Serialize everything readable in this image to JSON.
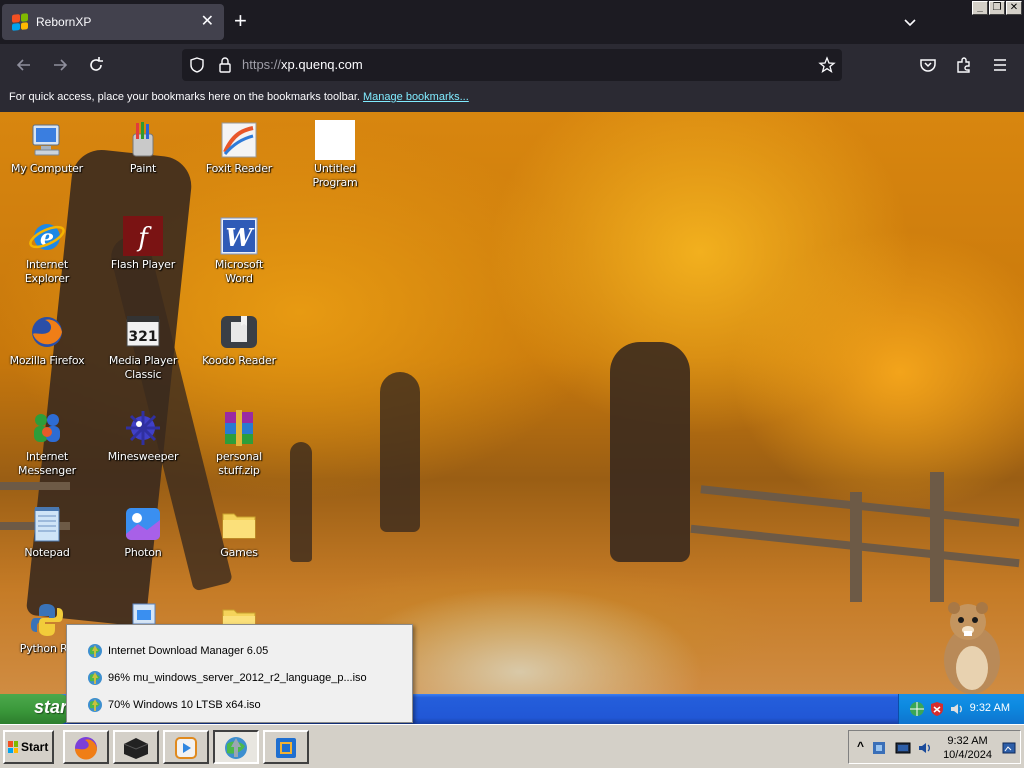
{
  "browser": {
    "tab_title": "RebornXP",
    "tab_close_glyph": "✕",
    "new_tab_glyph": "+",
    "url_scheme": "https://",
    "url_host": "xp.quenq.com",
    "bookmarks_hint": "For quick access, place your bookmarks here on the bookmarks toolbar.",
    "bookmarks_link": "Manage bookmarks...",
    "window_controls": [
      "_",
      "❐",
      "✕"
    ]
  },
  "desktop": {
    "icons": [
      {
        "label": "My Computer",
        "icon": "computer-icon"
      },
      {
        "label": "Paint",
        "icon": "paint-icon"
      },
      {
        "label": "Foxit Reader",
        "icon": "foxit-reader-icon"
      },
      {
        "label": "Untitled Program",
        "icon": "blank-program-icon"
      },
      {
        "label": "Internet Explorer",
        "icon": "internet-explorer-icon"
      },
      {
        "label": "Flash Player",
        "icon": "flash-player-icon"
      },
      {
        "label": "Microsoft Word",
        "icon": "word-icon"
      },
      {
        "label": "Mozilla Firefox",
        "icon": "firefox-icon"
      },
      {
        "label": "Media Player Classic",
        "icon": "media-player-classic-icon"
      },
      {
        "label": "Koodo Reader",
        "icon": "koodo-reader-icon"
      },
      {
        "label": "Internet Messenger",
        "icon": "messenger-icon"
      },
      {
        "label": "Minesweeper",
        "icon": "minesweeper-icon"
      },
      {
        "label": "personal stuff.zip",
        "icon": "winrar-archive-icon"
      },
      {
        "label": "Notepad",
        "icon": "notepad-icon"
      },
      {
        "label": "Photon",
        "icon": "photon-icon"
      },
      {
        "label": "Games",
        "icon": "folder-icon"
      },
      {
        "label": "Python RE",
        "icon": "python-icon"
      }
    ]
  },
  "xp_taskbar": {
    "start_label": "start",
    "time": "9:32 AM"
  },
  "download_popup": {
    "items": [
      "Internet Download Manager 6.05",
      "96% mu_windows_server_2012_r2_language_p...iso",
      "70% Windows 10 LTSB x64.iso"
    ]
  },
  "host_taskbar": {
    "start_label": "Start",
    "time": "9:32 AM",
    "date": "10/4/2024",
    "tray_arrow": "^"
  },
  "colors": {
    "browser_dark": "#1c1b22",
    "browser_toolbar": "#2b2a33",
    "link": "#80ebff",
    "xp_blue": "#245edb",
    "xp_green": "#3c9a3c",
    "host_gray": "#d4d0c8"
  }
}
